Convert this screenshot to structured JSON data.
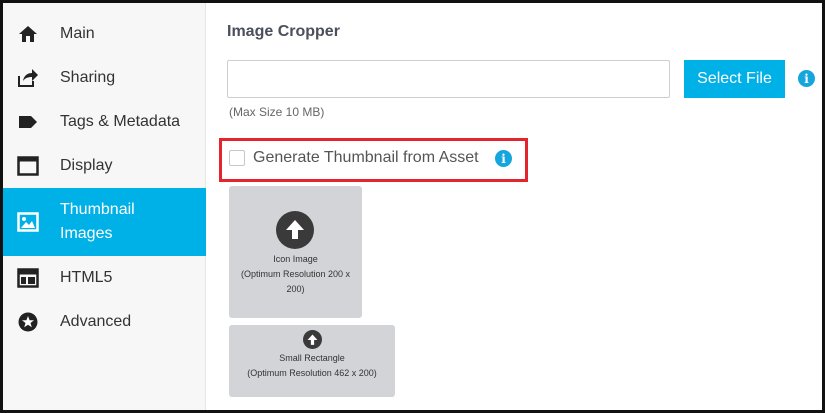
{
  "sidebar": {
    "items": [
      {
        "label": "Main",
        "icon": "home-icon"
      },
      {
        "label": "Sharing",
        "icon": "share-icon"
      },
      {
        "label": "Tags & Metadata",
        "icon": "tag-icon"
      },
      {
        "label": "Display",
        "icon": "display-icon"
      },
      {
        "label": "Thumbnail\nImages",
        "icon": "image-icon",
        "active": true
      },
      {
        "label": "HTML5",
        "icon": "html5-layout-icon"
      },
      {
        "label": "Advanced",
        "icon": "star-icon"
      }
    ]
  },
  "main": {
    "title": "Image Cropper",
    "file_input_value": "",
    "select_file_label": "Select File",
    "max_size_hint": "(Max Size 10 MB)",
    "generate_thumbnail_label": "Generate Thumbnail from Asset",
    "generate_thumbnail_checked": false,
    "thumbnails": [
      {
        "title": "Icon Image",
        "subtitle": "(Optimum Resolution 200 x 200)"
      },
      {
        "title": "Small Rectangle",
        "subtitle": "(Optimum Resolution 462 x 200)"
      }
    ]
  },
  "colors": {
    "accent": "#00b1e8",
    "highlight": "#e3262b",
    "thumb_bg": "#d2d4d8"
  }
}
